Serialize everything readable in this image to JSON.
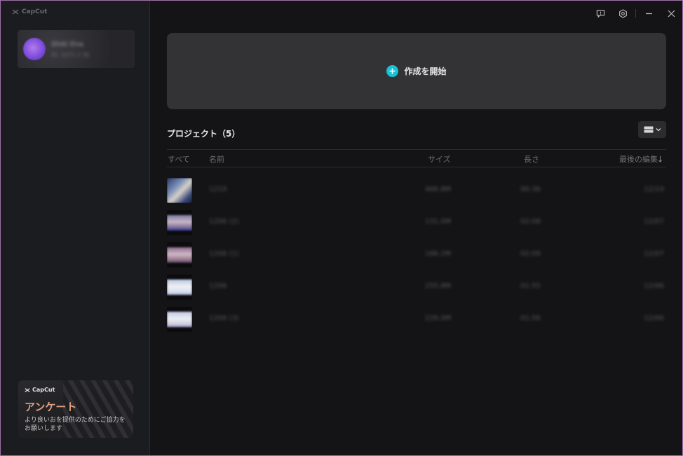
{
  "app": {
    "logo_text": "CapCut"
  },
  "sidebar": {
    "user_name": "Shiki Ena",
    "user_sub": "ID: 1071 2 36"
  },
  "survey": {
    "logo_text": "CapCut",
    "title": "アンケート",
    "description": "より良いおを提供のためにご協力をお願いします"
  },
  "titlebar": {
    "icons": [
      "feedback-icon",
      "settings-icon",
      "minimize-icon",
      "close-icon"
    ]
  },
  "create": {
    "label": "作成を開始",
    "accent": "#17c2d6"
  },
  "projects": {
    "title": "プロジェクト（5）",
    "columns": {
      "all": "すべて",
      "name": "名前",
      "size": "サイズ",
      "length": "長さ",
      "last_edited": "最後の編集"
    },
    "rows": [
      {
        "name": "1219",
        "size": "466.8M",
        "length": "00:36",
        "date": "12/19"
      },
      {
        "name": "1206 (2)",
        "size": "131.0M",
        "length": "02:08",
        "date": "12/07"
      },
      {
        "name": "1206 (1)",
        "size": "186.2M",
        "length": "02:09",
        "date": "12/07"
      },
      {
        "name": "1206",
        "size": "255.8M",
        "length": "01:55",
        "date": "12/06"
      },
      {
        "name": "1206 (3)",
        "size": "226.0M",
        "length": "01:56",
        "date": "12/06"
      }
    ]
  }
}
